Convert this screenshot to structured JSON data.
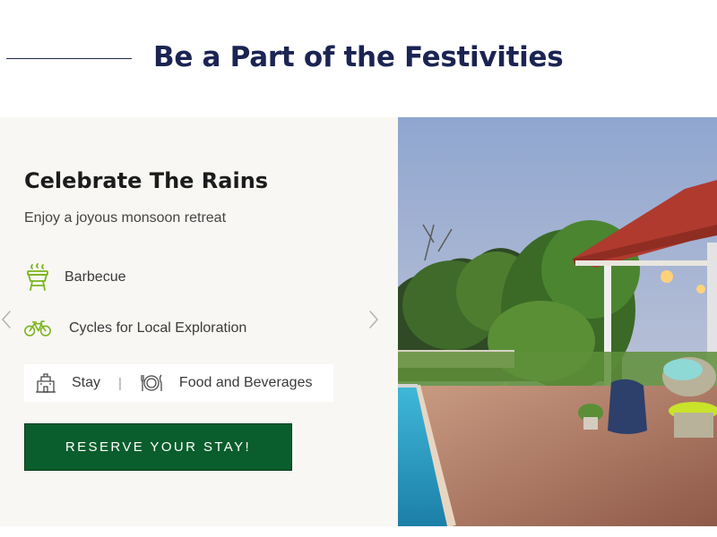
{
  "section": {
    "title": "Be a Part of the Festivities"
  },
  "offer": {
    "title": "Celebrate The Rains",
    "subtitle": "Enjoy a joyous monsoon retreat",
    "features": [
      {
        "label": "Barbecue",
        "icon": "grill-icon"
      },
      {
        "label": "Cycles for Local Exploration",
        "icon": "bicycle-icon"
      }
    ],
    "amenities": [
      {
        "label": "Stay",
        "icon": "hotel-icon"
      },
      {
        "label": "Food and Beverages",
        "icon": "dining-icon"
      }
    ],
    "separator": "|",
    "cta_label": "RESERVE YOUR STAY!"
  },
  "carousel": {
    "prev_icon": "chevron-left-icon",
    "next_icon": "chevron-right-icon",
    "photo_alt": "Resort patio with pool and red-tiled gazebo at dusk"
  },
  "colors": {
    "heading": "#1b2452",
    "panel_bg": "#f8f7f3",
    "accent_green": "#7ab51d",
    "button_green": "#0a5d2c"
  }
}
